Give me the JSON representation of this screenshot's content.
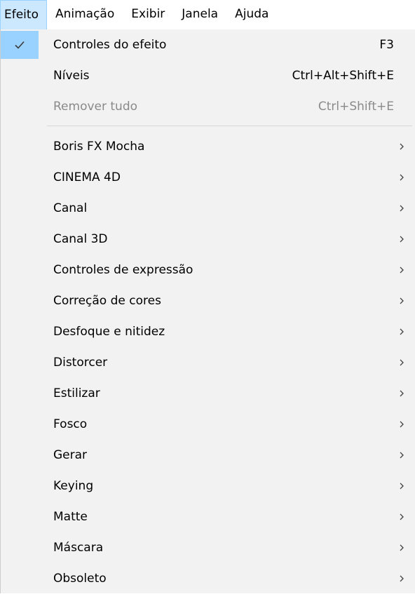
{
  "menubar": {
    "items": [
      "Efeito",
      "Animação",
      "Exibir",
      "Janela",
      "Ajuda"
    ],
    "active": "Efeito"
  },
  "menu": {
    "top_items": [
      {
        "label": "Controles do efeito",
        "shortcut": "F3",
        "checked": true,
        "enabled": true
      },
      {
        "label": "Níveis",
        "shortcut": "Ctrl+Alt+Shift+E",
        "checked": false,
        "enabled": true
      },
      {
        "label": "Remover tudo",
        "shortcut": "Ctrl+Shift+E",
        "checked": false,
        "enabled": false
      }
    ],
    "submenus": [
      "Boris FX Mocha",
      "CINEMA 4D",
      "Canal",
      "Canal 3D",
      "Controles de expressão",
      "Correção de cores",
      "Desfoque e nitidez",
      "Distorcer",
      "Estilizar",
      "Fosco",
      "Gerar",
      "Keying",
      "Matte",
      "Máscara",
      "Obsoleto"
    ]
  },
  "colors": {
    "menu_background": "#f2f2f2",
    "highlight": "#99d1ff",
    "active_menubar": "#cce8ff",
    "disabled_text": "#8a8a8a"
  }
}
